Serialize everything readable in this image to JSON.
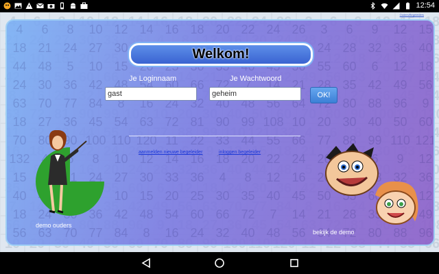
{
  "status_bar": {
    "time": "12:54",
    "left_icons": [
      "app-icon",
      "image-icon",
      "warning-icon",
      "gmail-icon",
      "camera-icon",
      "phone-icon",
      "android-icon",
      "briefcase-icon"
    ],
    "right_icons": [
      "bluetooth-icon",
      "wifi-icon",
      "signal-icon",
      "battery-icon"
    ]
  },
  "app": {
    "tiny_link": "Ouders/Begeleiders",
    "title": "Welkom!",
    "login_label": "Je Loginnaam",
    "login_value": "gast",
    "password_label": "Je Wachtwoord",
    "password_value": "geheim",
    "ok_label": "OK!",
    "link_register": "aanmelden nieuwe begeleider",
    "link_login": "inloggen begeleider",
    "demo_parents": "demo ouders",
    "demo_view": "bekijk de demo",
    "bg_numbers": [
      "4",
      "6",
      "8",
      "10",
      "12",
      "14",
      "16",
      "18",
      "20",
      "22",
      "24",
      "26",
      "3",
      "6",
      "9",
      "12",
      "15",
      "18",
      "21",
      "24",
      "27",
      "30",
      "33",
      "36",
      "4",
      "8",
      "12",
      "16",
      "20",
      "24",
      "28",
      "32",
      "36",
      "40",
      "44",
      "48",
      "5",
      "10",
      "15",
      "20",
      "25",
      "30",
      "35",
      "40",
      "45",
      "50",
      "55",
      "60",
      "6",
      "12",
      "18",
      "24",
      "30",
      "36",
      "42",
      "48",
      "54",
      "60",
      "66",
      "72",
      "7",
      "14",
      "21",
      "28",
      "35",
      "42",
      "49",
      "56",
      "63",
      "70",
      "77",
      "84",
      "8",
      "16",
      "24",
      "32",
      "40",
      "48",
      "56",
      "64",
      "72",
      "80",
      "88",
      "96",
      "9",
      "18",
      "27",
      "36",
      "45",
      "54",
      "63",
      "72",
      "81",
      "90",
      "99",
      "108",
      "10",
      "20",
      "30",
      "40",
      "50",
      "60",
      "70",
      "80",
      "90",
      "100",
      "110",
      "120",
      "11",
      "22",
      "33",
      "44",
      "55",
      "66",
      "77",
      "88",
      "99",
      "110",
      "121",
      "132"
    ]
  },
  "colors": {
    "panel_start": "#78aff5",
    "panel_end": "#8c5fc8",
    "title_fill": "#3a63d1",
    "ok_fill": "#3b7fd6",
    "link": "#1a37d8",
    "teacher_circle": "#2ea12e"
  }
}
